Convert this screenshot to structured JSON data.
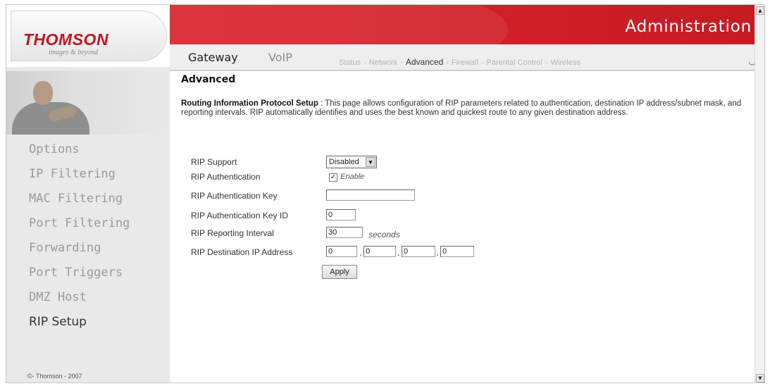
{
  "brand": {
    "logo": "THOMSON",
    "tagline": "images & beyond"
  },
  "header": {
    "title": "Administration"
  },
  "topnav": {
    "gateway": "Gateway",
    "voip": "VoIP",
    "submenu": [
      "Status",
      "Network",
      "Advanced",
      "Firewall",
      "Parental Control",
      "Wireless"
    ],
    "separator": "-",
    "current": "Advanced"
  },
  "sidebar": {
    "items": [
      {
        "label": "Options"
      },
      {
        "label": "IP Filtering"
      },
      {
        "label": "MAC Filtering"
      },
      {
        "label": "Port Filtering"
      },
      {
        "label": "Forwarding"
      },
      {
        "label": "Port Triggers"
      },
      {
        "label": "DMZ Host"
      },
      {
        "label": "RIP Setup"
      }
    ],
    "active": "RIP Setup",
    "copyright": "©- Thomson - 2007"
  },
  "page": {
    "title": "Advanced",
    "desc_heading": "Routing Information Protocol Setup",
    "desc_body": " :  This page allows configuration of RIP parameters related to authentication, destination IP address/subnet mask, and reporting intervals. RIP automatically identifies and uses the best known and quickest route to any given destination address."
  },
  "form": {
    "rip_support": {
      "label": "RIP Support",
      "value": "Disabled"
    },
    "rip_auth": {
      "label": "RIP Authentication",
      "checkbox_label": "Enable",
      "checked": true
    },
    "rip_auth_key": {
      "label": "RIP Authentication Key",
      "value": ""
    },
    "rip_auth_key_id": {
      "label": "RIP Authentication Key ID",
      "value": "0"
    },
    "rip_interval": {
      "label": "RIP Reporting Interval",
      "value": "30",
      "unit": "seconds"
    },
    "rip_dest_ip": {
      "label": "RIP Destination IP Address",
      "octets": [
        "0",
        "0",
        "0",
        "0"
      ]
    },
    "apply_label": "Apply"
  },
  "colors": {
    "header_red": "#d01f28",
    "logo_red": "#c4161c",
    "sidebar_bg": "#e9e9e9"
  }
}
